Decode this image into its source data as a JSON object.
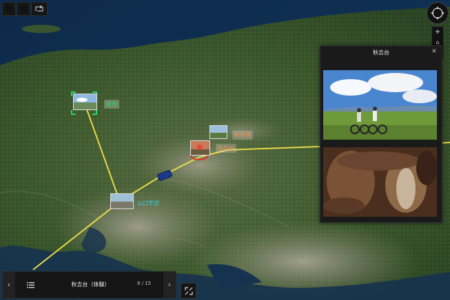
{
  "toolbar": {
    "buttons": [
      "blank",
      "blank",
      "route"
    ]
  },
  "map": {
    "pins": [
      {
        "label": "萩市",
        "color": "#2bd66b"
      },
      {
        "label": "秋芳洞",
        "color": "#ff8a4a"
      },
      {
        "label": "秋吉台",
        "color": "#ff8a4a"
      },
      {
        "label": "山口宇部",
        "color": "#35d0e0"
      }
    ]
  },
  "panel": {
    "title": "秋吉台",
    "close_icon": "close-icon",
    "photos": [
      "cyclists-on-plateau",
      "limestone-cave"
    ]
  },
  "bottom_bar": {
    "title": "秋吉台（体験）",
    "counter": "9 / 15",
    "prev_icon": "chevron-left-icon",
    "next_icon": "chevron-right-icon",
    "list_icon": "list-icon"
  },
  "controls": {
    "compass_icon": "compass-icon",
    "zoom_in": "+",
    "zoom_reset": "⌂",
    "fullscreen_icon": "fullscreen-icon"
  }
}
